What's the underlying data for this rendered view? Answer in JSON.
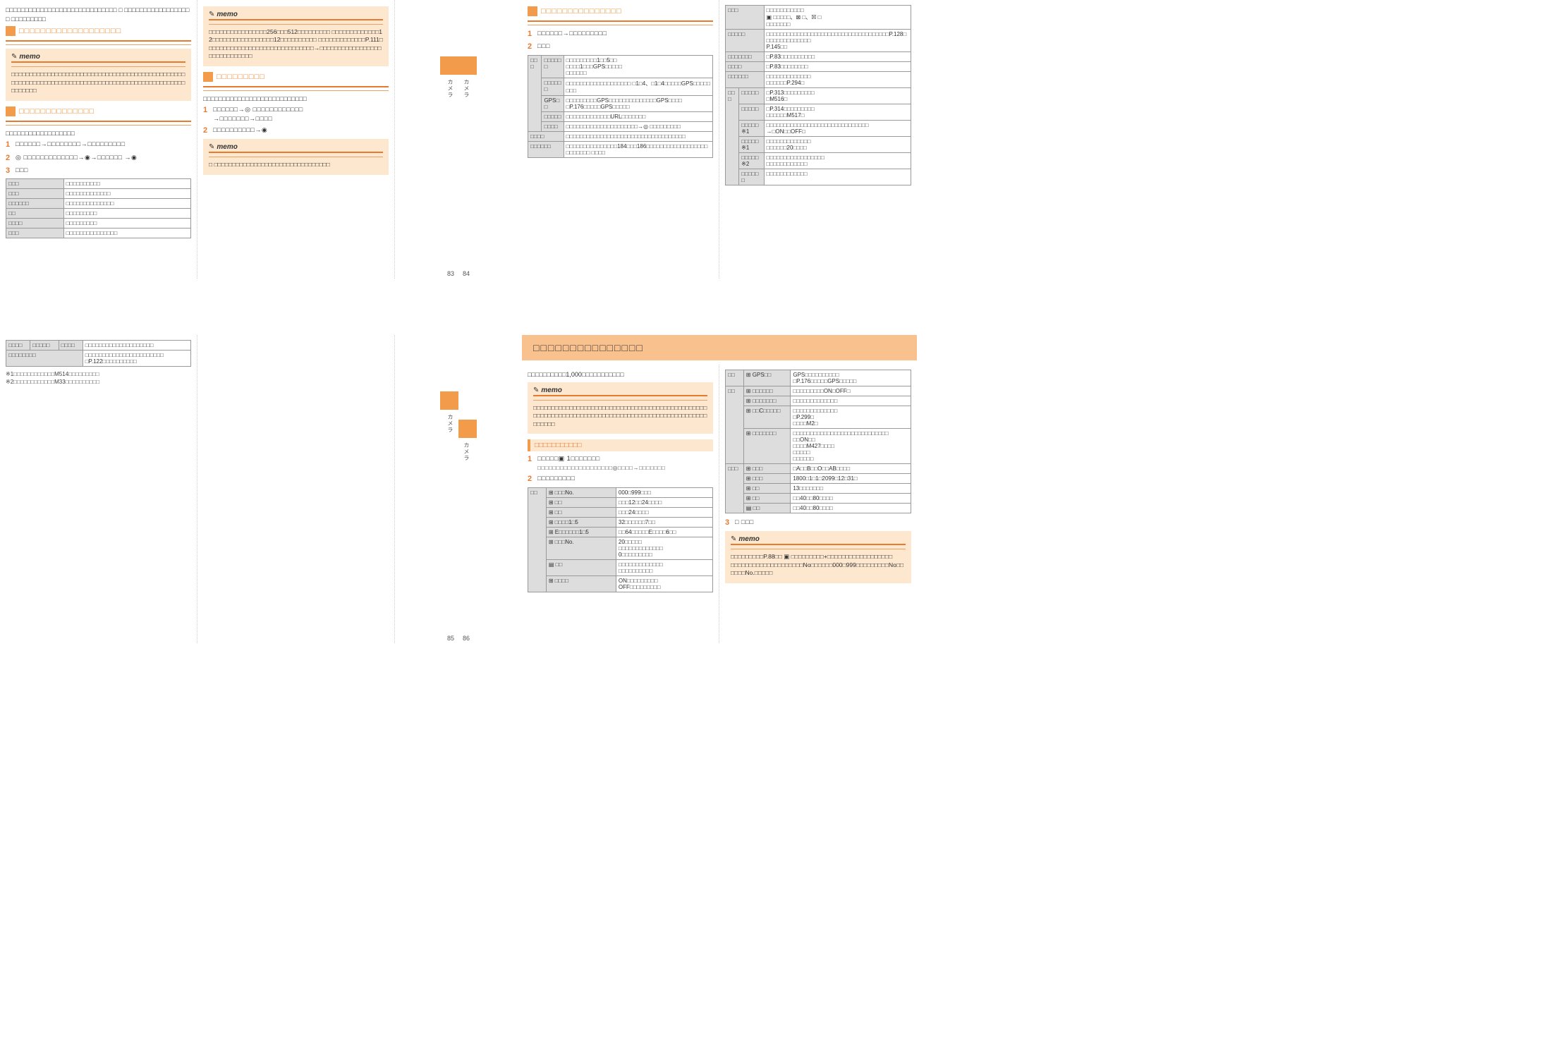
{
  "memo_label": "memo",
  "pages": {
    "p83": "83",
    "p84": "84",
    "p85": "85",
    "p86": "86"
  },
  "tab_text": "カメラ",
  "p1": {
    "top_text": "□□□□□□□□□□□□□□□□□□□□□□□□□□□□□ □ □□□□□□□□□□□□□□□□□□ □□□□□□□□□",
    "sec_title_1": "□□□□□□□□□□□□□□□□□□□",
    "memo1": "□□□□□□□□□□□□□□□□□□□□□□□□□□□□□□□□□□□□□□□□□□□□□□□□□□□□□□□□□□□□□□□□□□□□□□□□□□□□□□□□□□□□□□□□□□□□□□□□□□□□□□□",
    "sec_title_2": "□□□□□□□□□□□□□□",
    "sub_desc": "□□□□□□□□□□□□□□□□□□",
    "step1": "□□□□□□→□□□□□□□□→□□□□□□□□□",
    "step2": "◎ □□□□□□□□□□□□□→◉→□□□□□□ →◉",
    "step3": "□□□",
    "tbl": [
      [
        "□□□",
        "□□□□□□□□□□"
      ],
      [
        "□□□",
        "□□□□□□□□□□□□□"
      ],
      [
        "□□□□□□",
        "□□□□□□□□□□□□□□"
      ],
      [
        "□□",
        "□□□□□□□□□"
      ],
      [
        "□□□□",
        "□□□□□□□□□"
      ],
      [
        "□□□",
        "□□□□□□□□□□□□□□□"
      ]
    ]
  },
  "p2": {
    "memo1": "□□□□□□□□□□□□□□□□256□□□512□□□□□□□□□ □□□□□□□□□□□□□12□□□□□□□□□□□□□□□□□12□□□□□□□□□□ □□□□□□□□□□□□□P.111□□□□□□□□□□□□□□□□□□□□□□□□□□□□□□→□□□□□□□□□□□□□□□□□□□□□□□□□□□□□",
    "sec_title": "□□□□□□□□□",
    "sub_desc": "□□□□□□□□□□□□□□□□□□□□□□□□□□□",
    "step1": "□□□□□□→◎ □□□□□□□□□□□□\n→□□□□□□□→□□□□",
    "step2": "□□□□□□□□□□→◉",
    "memo2": "□ □□□□□□□□□□□□□□□□□□□□□□□□□□□□□□□□"
  },
  "p3": {
    "sec_title": "□□□□□□□□□□□□□□□",
    "step1": "□□□□□□→□□□□□□□□□",
    "step2": "□□□",
    "tbl_rows": [
      {
        "h": [
          "□□□",
          "□□□□□□"
        ],
        "t": "□□□□□□□□□1□□5□□\n□□□□1□□□GPS□□□□□\n□□□□□□"
      },
      {
        "h": [
          "",
          "□□□□□□"
        ],
        "t": "□□□□□□□□□□□□□□□□□□□ □1□4、□1□4□□□□□GPS□□□□□□□□"
      },
      {
        "h": [
          "",
          "GPS□□"
        ],
        "t": "□□□□□□□□□GPS□□□□□□□□□□□□□□GPS□□□□\n□P.176□□□□□GPS□□□□□"
      },
      {
        "h": [
          "",
          "□□□□□"
        ],
        "t": "□□□□□□□□□□□□□URL□□□□□□□"
      },
      {
        "h": [
          "",
          "□□□□"
        ],
        "t": "□□□□□□□□□□□□□□□□□□□□□→◎ □□□□□□□□□"
      },
      {
        "h2": "□□□□",
        "t": "□□□□□□□□□□□□□□□□□□□□□□□□□□□□□□□□□□□"
      },
      {
        "h2": "□□□□□□",
        "t": "□□□□□□□□□□□□□□□184□□□186□□□□□□□□□□□□□□□□□□□□□□□□□ □□□□"
      }
    ]
  },
  "p4": {
    "tbl_rows": [
      {
        "h": "□□□",
        "t": "□□□□□□□□□□□\n▣ □□□□□、⊠ □、☒ □\n□□□□□□□"
      },
      {
        "h": "□□□□□",
        "t": "□□□□□□□□□□□□□□□□□□□□□□□□□□□□□□□□□□□□P.128□□□□□□□□□□□□□□\nP.145□□"
      },
      {
        "h": "□□□□□□□",
        "t": "□P.83□□□□□□□□□□"
      },
      {
        "h": "□□□□",
        "t": "□P.83□□□□□□□□"
      },
      {
        "h": "□□□□□□",
        "t": "□□□□□□□□□□□□□\n□□□□□□P.294□"
      },
      {
        "h": [
          "□□□",
          "□□□□□"
        ],
        "t": "□P.313□□□□□□□□□\n□M516□"
      },
      {
        "h": [
          "",
          "□□□□□"
        ],
        "t": "□P.314□□□□□□□□□\n□□□□□□M517□"
      },
      {
        "h": [
          "",
          "□□□□□※1"
        ],
        "t": "□□□□□□□□□□□□□□□□□□□□□□□□□□□□□□\n→□ON□□OFF□"
      },
      {
        "h": [
          "",
          "□□□□□※1"
        ],
        "t": "□□□□□□□□□□□□□\n□□□□□□20□□□□"
      },
      {
        "h": [
          "",
          "□□□□□※2"
        ],
        "t": "□□□□□□□□□□□□□□□□□\n□□□□□□□□□□□□"
      },
      {
        "h": [
          "",
          "□□□□□□"
        ],
        "t": "□□□□□□□□□□□□"
      }
    ]
  },
  "p5": {
    "tbl_rows": [
      {
        "h": [
          "□□□□",
          "□□□□□",
          "□□□□"
        ],
        "t": "□□□□□□□□□□□□□□□□□□□□"
      },
      {
        "h": "□□□□□□□□",
        "t": "□□□□□□□□□□□□□□□□□□□□□□□\n□P.122□□□□□□□□□□"
      }
    ],
    "foot1": "※1□□□□□□□□□□□□M514□□□□□□□□□",
    "foot2": "※2□□□□□□□□□□□□M33□□□□□□□□□□"
  },
  "banner_title": "□□□□□□□□□□□□□□□",
  "p7": {
    "intro": "□□□□□□□□□□1,000□□□□□□□□□□□",
    "memo1": "□□□□□□□□□□□□□□□□□□□□□□□□□□□□□□□□□□□□□□□□□□□□□□□□□□□□□□□□□□□□□□□□□□□□□□□□□□□□□□□□□□□□□□□□□□□□□□□□□□□□□□",
    "sub_bar": "□□□□□□□□□□□",
    "step1": "□□□□□▣ 1□□□□□□□",
    "step1_sub": "□□□□□□□□□□□□□□□□□□□□◎□□□□→□□□□□□□",
    "step2": "□□□□□□□□□",
    "tbl": [
      [
        "□□",
        "⊞ □□□No.",
        "000□999□□□"
      ],
      [
        "",
        "⊞ □□",
        "□□□12□□24□□□□"
      ],
      [
        "",
        "⊞ □□",
        "□□□24□□□□"
      ],
      [
        "",
        "⊞ □□□□1□5",
        "32□□□□□□7□□"
      ],
      [
        "",
        "⊞ E□□□□□□1□5",
        "□□64□□□□□E□□□□6□□"
      ],
      [
        "",
        "⊞ □□□No.",
        "20□□□□□\n□□□□□□□□□□□□□\n0□□□□□□□□□"
      ],
      [
        "",
        "▤ □□",
        "□□□□□□□□□□□□□\n□□□□□□□□□□"
      ],
      [
        "",
        "⊞ □□□□",
        "ON□□□□□□□□□\nOFF□□□□□□□□□"
      ]
    ]
  },
  "p8": {
    "tbl1": [
      [
        "□□",
        "⊞ GPS□□",
        "GPS□□□□□□□□□□\n□P.176□□□□□GPS□□□□□"
      ],
      [
        "□□",
        "⊞ □□□□□□",
        "□□□□□□□□□ON□OFF□"
      ],
      [
        "",
        "⊞ □□□□□□□",
        "□□□□□□□□□□□□□"
      ],
      [
        "",
        "⊞ □□C□□□□□",
        "□□□□□□□□□□□□□\n□P.299□\n□□□□M2□"
      ],
      [
        "",
        "⊞ □□□□□□□",
        "□□□□□□□□□□□□□□□□□□□□□□□□□□□□\n□□ON□□\n□□□□M427□□□□\n□□□□□\n□□□□□□"
      ],
      [
        "□□□",
        "⊞ □□□",
        "□A□□B□□O□□AB□□□□"
      ],
      [
        "",
        "⊞ □□□",
        "1800□1□1□2099□12□31□"
      ],
      [
        "",
        "⊞ □□",
        "13□□□□□□□"
      ],
      [
        "",
        "⊞ □□",
        "□□40□□80□□□□"
      ],
      [
        "",
        "▤ □□",
        "□□40□□80□□□□"
      ]
    ],
    "step3": "□ □□□",
    "memo": "□□□□□□□□□P.88□□ ▣ □□□□□□□□□+□□□□□□□□□□□□□□□□□□\n□□□□□□□□□□□□□□□□□□□□No□□□□□□000□999□□□□□□□□□No□□□□□□No.□□□□□"
  }
}
